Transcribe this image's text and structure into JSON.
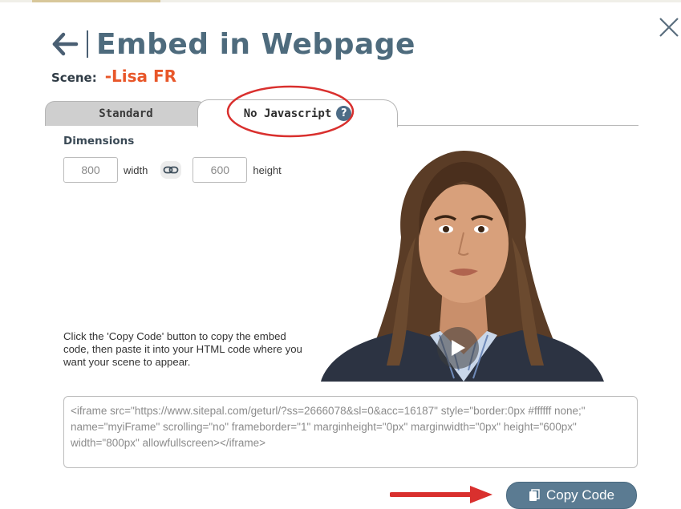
{
  "dialog": {
    "title": "Embed in Webpage",
    "scene_label": "Scene:",
    "scene_name": "-Lisa FR"
  },
  "icons": {
    "back": "arrow-left-icon",
    "close": "close-icon",
    "help": "question-circle-icon",
    "link": "chain-link-icon",
    "play": "play-icon",
    "copy": "copy-icon"
  },
  "tabs": [
    {
      "label": "Standard",
      "active": false
    },
    {
      "label": "No Javascript",
      "active": true
    }
  ],
  "help_glyph": "?",
  "dimensions": {
    "title": "Dimensions",
    "width_value": "800",
    "width_label": "width",
    "height_value": "600",
    "height_label": "height"
  },
  "instructions": "Click the 'Copy Code' button to copy the embed code, then paste it into your HTML code where you want your scene to appear.",
  "embed_code": "<iframe src=\"https://www.sitepal.com/geturl/?ss=2666078&sl=0&acc=16187\" style=\"border:0px #ffffff none;\" name=\"myiFrame\" scrolling=\"no\" frameborder=\"1\" marginheight=\"0px\" marginwidth=\"0px\" height=\"600px\" width=\"800px\" allowfullscreen></iframe>",
  "copy_button": "Copy Code",
  "colors": {
    "title": "#4e6b7d",
    "scene_name": "#e8572a",
    "button": "#5b7b92",
    "annotation_red": "#d9302e"
  }
}
